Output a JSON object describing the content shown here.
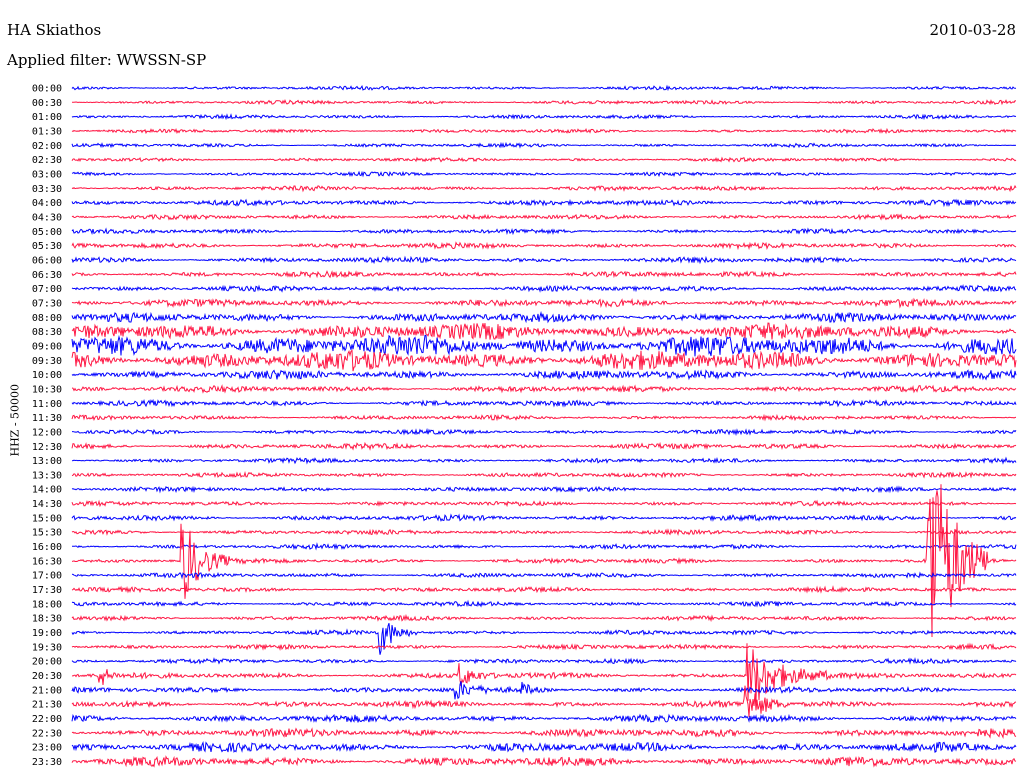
{
  "header": {
    "station": "HA Skiathos",
    "date": "2010-03-28",
    "filter": "Applied filter: WWSSN-SP",
    "channel_label": "HHZ - 50000"
  },
  "colors": {
    "even": "#0000ff",
    "odd": "#ff1744"
  },
  "chart_data": {
    "type": "helicorder",
    "title": "HA Skiathos",
    "date": "2010-03-28",
    "filter": "WWSSN-SP",
    "ylabel": "HHZ - 50000",
    "row_labels": [
      "00:00",
      "00:30",
      "01:00",
      "01:30",
      "02:00",
      "02:30",
      "03:00",
      "03:30",
      "04:00",
      "04:30",
      "05:00",
      "05:30",
      "06:00",
      "06:30",
      "07:00",
      "07:30",
      "08:00",
      "08:30",
      "09:00",
      "09:30",
      "10:00",
      "10:30",
      "11:00",
      "11:30",
      "12:00",
      "12:30",
      "13:00",
      "13:30",
      "14:00",
      "14:30",
      "15:00",
      "15:30",
      "16:00",
      "16:30",
      "17:00",
      "17:30",
      "18:00",
      "18:30",
      "19:00",
      "19:30",
      "20:00",
      "20:30",
      "21:00",
      "21:30",
      "22:00",
      "22:30",
      "23:00",
      "23:30"
    ],
    "minutes_per_row": 30,
    "row_noise_amplitude": [
      2,
      2,
      2,
      2,
      2,
      2,
      2,
      2.5,
      3,
      2.5,
      2.5,
      3,
      3,
      3,
      3,
      4,
      5,
      9,
      12,
      11,
      5,
      3.5,
      3,
      2.5,
      2.5,
      3,
      2.5,
      2.5,
      2.5,
      2.5,
      3,
      2.5,
      2.5,
      2.5,
      2.5,
      2.5,
      2.5,
      2.5,
      2.5,
      2.5,
      2.5,
      3,
      3,
      3.5,
      4,
      4.5,
      5,
      5
    ],
    "events": [
      {
        "row": 33,
        "minute": 3.5,
        "amplitude": 48,
        "duration_min": 1.5
      },
      {
        "row": 38,
        "minute": 9.8,
        "amplitude": 22,
        "duration_min": 1.2
      },
      {
        "row": 41,
        "minute": 0.9,
        "amplitude": 14,
        "duration_min": 0.5
      },
      {
        "row": 41,
        "minute": 12.3,
        "amplitude": 12,
        "duration_min": 1.3
      },
      {
        "row": 42,
        "minute": 12.2,
        "amplitude": 10,
        "duration_min": 1.0
      },
      {
        "row": 42,
        "minute": 14.3,
        "amplitude": 6,
        "duration_min": 1.0
      },
      {
        "row": 41,
        "minute": 21.5,
        "amplitude": 36,
        "duration_min": 2.5
      },
      {
        "row": 43,
        "minute": 21.4,
        "amplitude": 20,
        "duration_min": 1.5
      },
      {
        "row": 33,
        "minute": 27.2,
        "amplitude": 140,
        "duration_min": 2.0
      }
    ]
  }
}
